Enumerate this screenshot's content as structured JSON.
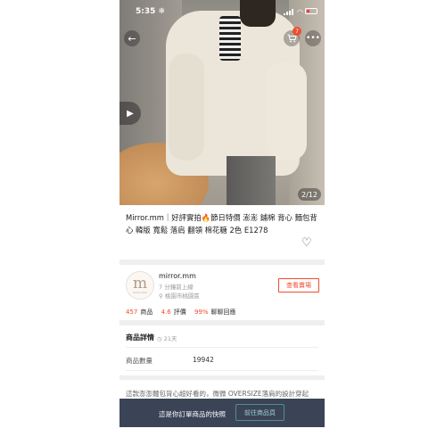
{
  "status_bar": {
    "time": "5:35",
    "time_icon": "snowflake-icon"
  },
  "nav": {
    "back_icon": "←",
    "cart_badge": "7",
    "more_icon": "•••"
  },
  "gallery": {
    "pager": "2/12",
    "play_icon": "▶"
  },
  "product": {
    "title": "Mirror.mm｜好評實拍🔥節日特價 澎澎 鋪棉 背心 麵包背心 韓版 寬鬆 落肩 翻領 棉花糖 2色 E1278",
    "heart_icon": "♡"
  },
  "shop": {
    "logo_letter": "m",
    "logo_sub": "mirror.mm",
    "name": "mirror.mm",
    "online": "7 分鐘前上線",
    "location": "桃園市桃園區",
    "view_button": "查看賣場",
    "stats": [
      {
        "value": "457",
        "label": "商品"
      },
      {
        "value": "4.6",
        "label": "評價"
      },
      {
        "value": "99%",
        "label": "聊聊回應"
      }
    ]
  },
  "details": {
    "heading": "商品詳情",
    "updated": "21天",
    "quantity_label": "商品數量",
    "quantity_value": "19942",
    "description": "這款澎澎麵包背心超好看的，微微 OVERSIZE落肩的設計穿起"
  },
  "bottom_bar": {
    "text": "這是你訂單商品的快照",
    "button": "前往商品頁"
  },
  "colors": {
    "accent": "#ee4d2d",
    "bottom_bar": "#3b4357",
    "teal": "#4e8f92"
  }
}
